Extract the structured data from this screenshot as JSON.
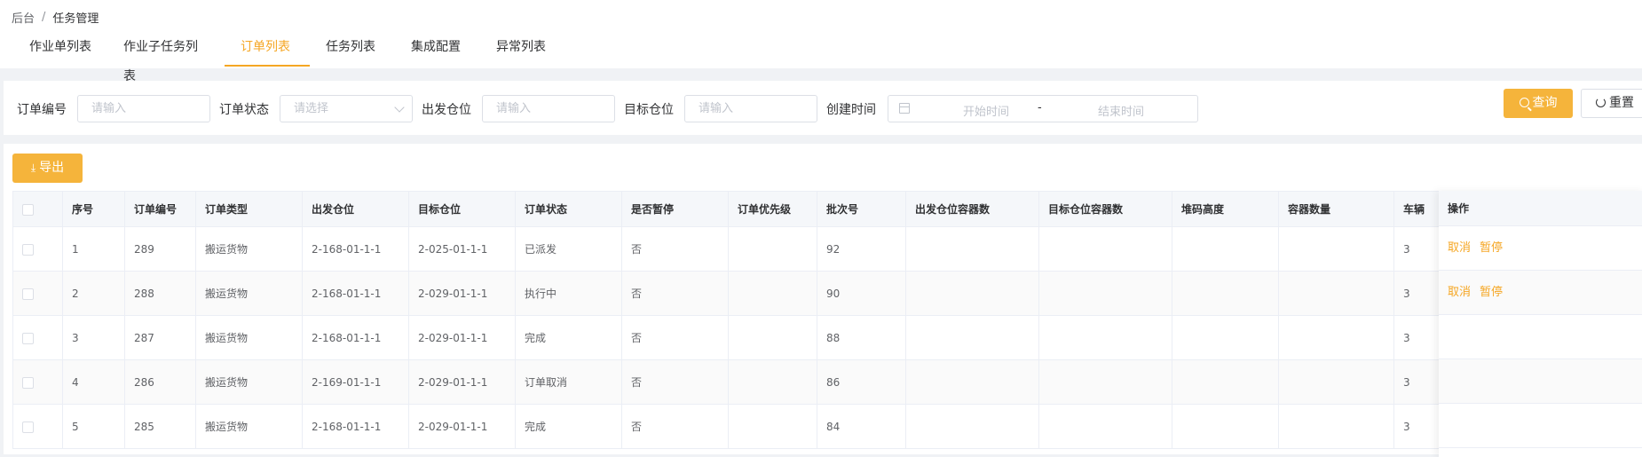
{
  "breadcrumb": {
    "home": "后台",
    "separator": "/",
    "current": "任务管理"
  },
  "tabs": [
    {
      "label": "作业单列表"
    },
    {
      "label": "作业子任务列表"
    },
    {
      "label": "订单列表"
    },
    {
      "label": "任务列表"
    },
    {
      "label": "集成配置"
    },
    {
      "label": "异常列表"
    }
  ],
  "search": {
    "order_no_label": "订单编号",
    "order_no_placeholder": "请输入",
    "order_status_label": "订单状态",
    "order_status_placeholder": "请选择",
    "from_loc_label": "出发仓位",
    "from_loc_placeholder": "请输入",
    "to_loc_label": "目标仓位",
    "to_loc_placeholder": "请输入",
    "created_label": "创建时间",
    "start_placeholder": "开始时间",
    "range_sep": "-",
    "end_placeholder": "结束时间",
    "query_label": "查询",
    "reset_label": "重置"
  },
  "toolbar": {
    "export_label": "导出"
  },
  "table": {
    "columns": [
      "序号",
      "订单编号",
      "订单类型",
      "出发仓位",
      "目标仓位",
      "订单状态",
      "是否暂停",
      "订单优先级",
      "批次号",
      "出发仓位容器数",
      "目标仓位容器数",
      "堆码高度",
      "容器数量",
      "车辆"
    ],
    "ops_header": "操作",
    "rows": [
      {
        "cells": [
          "1",
          "289",
          "搬运货物",
          "2-168-01-1-1",
          "2-025-01-1-1",
          "已派发",
          "否",
          "",
          "92",
          "",
          "",
          "",
          "",
          "3"
        ],
        "ops": [
          "取消",
          "暂停"
        ]
      },
      {
        "cells": [
          "2",
          "288",
          "搬运货物",
          "2-168-01-1-1",
          "2-029-01-1-1",
          "执行中",
          "否",
          "",
          "90",
          "",
          "",
          "",
          "",
          "3"
        ],
        "ops": [
          "取消",
          "暂停"
        ]
      },
      {
        "cells": [
          "3",
          "287",
          "搬运货物",
          "2-168-01-1-1",
          "2-029-01-1-1",
          "完成",
          "否",
          "",
          "88",
          "",
          "",
          "",
          "",
          "3"
        ],
        "ops": []
      },
      {
        "cells": [
          "4",
          "286",
          "搬运货物",
          "2-169-01-1-1",
          "2-029-01-1-1",
          "订单取消",
          "否",
          "",
          "86",
          "",
          "",
          "",
          "",
          "3"
        ],
        "ops": []
      },
      {
        "cells": [
          "5",
          "285",
          "搬运货物",
          "2-168-01-1-1",
          "2-029-01-1-1",
          "完成",
          "否",
          "",
          "84",
          "",
          "",
          "",
          "",
          "3"
        ],
        "ops": []
      }
    ]
  },
  "colors": {
    "accent": "#f5a623",
    "button_bg": "#f5b43b"
  }
}
